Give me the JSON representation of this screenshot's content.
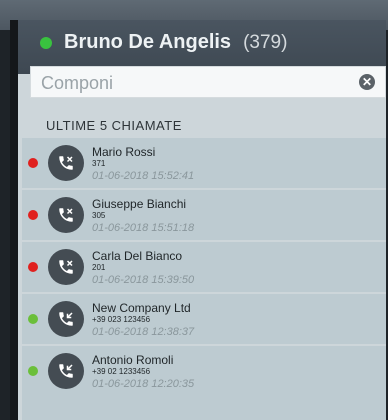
{
  "header": {
    "status_color": "#39c23f",
    "user_name": "Bruno De Angelis",
    "extension": "(379)"
  },
  "search": {
    "placeholder": "Componi",
    "value": "",
    "clear_icon": "clear-icon"
  },
  "recent_calls": {
    "title": "ULTIME 5 CHIAMATE",
    "items": [
      {
        "name": "Mario Rossi",
        "number": "371",
        "time": "01-06-2018 15:52:41",
        "status": "missed",
        "status_color": "#e0201e",
        "icon": "missed-call-icon"
      },
      {
        "name": "Giuseppe Bianchi",
        "number": "305",
        "time": "01-06-2018 15:51:18",
        "status": "missed",
        "status_color": "#e0201e",
        "icon": "missed-call-icon"
      },
      {
        "name": "Carla Del Bianco",
        "number": "201",
        "time": "01-06-2018 15:39:50",
        "status": "missed",
        "status_color": "#e0201e",
        "icon": "missed-call-icon"
      },
      {
        "name": "New Company Ltd",
        "number": "+39 023 123456",
        "time": "01-06-2018 12:38:37",
        "status": "answered",
        "status_color": "#6bbf3a",
        "icon": "incoming-call-icon"
      },
      {
        "name": "Antonio Romoli",
        "number": "+39 02 1233456",
        "time": "01-06-2018 12:20:35",
        "status": "answered",
        "status_color": "#6bbf3a",
        "icon": "incoming-call-icon"
      }
    ]
  }
}
